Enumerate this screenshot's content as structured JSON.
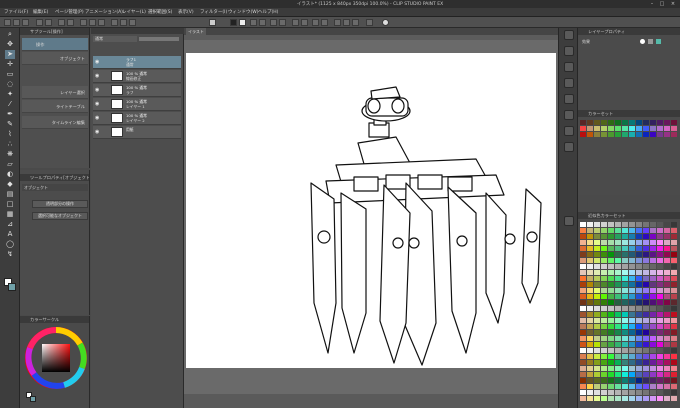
{
  "app": {
    "title": "イラスト* (1125 x 840px 350dpi 100.0%) - CLIP STUDIO PAINT EX",
    "window_buttons": [
      "–",
      "□",
      "×"
    ]
  },
  "menu": [
    "ファイル(F)",
    "編集(E)",
    "ページ管理(P)",
    "アニメーション(A)",
    "レイヤー(L)",
    "選択範囲(S)",
    "表示(V)",
    "フィルター(I)",
    "ウィンドウ(W)",
    "ヘルプ(H)"
  ],
  "subtool": {
    "header": "サブツール[操作]",
    "items": [
      "操作",
      "オブジェクト",
      "レイヤー選択",
      "ライトテーブル",
      "タイムライン編集"
    ]
  },
  "tool_property": {
    "header": "ツールプロパティ[オブジェクト]",
    "name": "オブジェクト",
    "buttons": [
      "透明部分の操作",
      "選択可能なオブジェクト"
    ]
  },
  "color_panel": {
    "header": "カラーサークル"
  },
  "layers": {
    "blend_mode": "通常",
    "items": [
      {
        "name": "ラフ1",
        "sub": "通常"
      },
      {
        "name": "100 % 通常",
        "sub": "線画修正"
      },
      {
        "name": "100 % 通常",
        "sub": "ラフ"
      },
      {
        "name": "100 % 通常",
        "sub": "レイヤー 1"
      },
      {
        "name": "100 % 通常",
        "sub": "レイヤー 2"
      },
      {
        "name": "",
        "sub": "用紙"
      }
    ]
  },
  "canvas": {
    "tab": "イラスト"
  },
  "navigator": {
    "header": "レイヤープロパティ",
    "label": "効果"
  },
  "palette_a": {
    "header": "カラーセット"
  },
  "palette_b": {
    "header": "近似色カラーセット"
  },
  "colors": {
    "accent": "#6a8898",
    "paper": "#ffffff",
    "canvas_bg": "#6a6a6a"
  }
}
